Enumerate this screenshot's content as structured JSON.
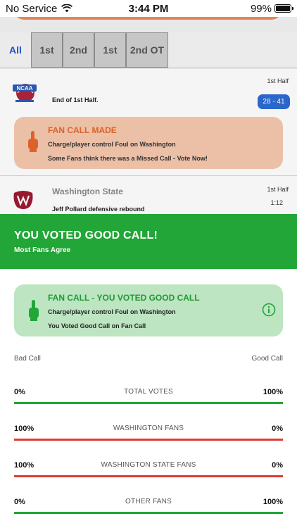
{
  "status": {
    "carrier": "No Service",
    "time": "3:44 PM",
    "battery_pct": "99%",
    "battery_level": 0.99
  },
  "tabs": {
    "items": [
      {
        "label": "All",
        "selected": true
      },
      {
        "label": "1st"
      },
      {
        "label": "2nd"
      },
      {
        "label": "1st"
      },
      {
        "label": "2nd OT"
      }
    ]
  },
  "feed": {
    "row1": {
      "text": "End of 1st Half.",
      "half": "1st Half",
      "score": "28 - 41",
      "logo_text": "NCAA"
    },
    "fan_call_made": {
      "title": "FAN CALL MADE",
      "detail": "Charge/player control Foul on Washington",
      "prompt_prefix": "Some Fans think there was a Missed Call - ",
      "prompt_cta": "Vote Now!"
    },
    "row2": {
      "team": "Washington State",
      "text": "Jeff Pollard defensive rebound",
      "half": "1st Half",
      "clock": "1:12"
    }
  },
  "sheet": {
    "banner_title": "YOU VOTED GOOD CALL!",
    "banner_sub": "Most Fans Agree",
    "card": {
      "title": "FAN CALL - YOU VOTED GOOD CALL",
      "detail": "Charge/player control Foul on Washington",
      "note": "You Voted Good Call on Fan Call"
    },
    "scale_left": "Bad Call",
    "scale_right": "Good Call",
    "rows": [
      {
        "label": "TOTAL VOTES",
        "bad": "0%",
        "good": "100%",
        "good_fraction": 1.0
      },
      {
        "label": "WASHINGTON FANS",
        "bad": "100%",
        "good": "0%",
        "good_fraction": 0.0
      },
      {
        "label": "WASHINGTON STATE FANS",
        "bad": "100%",
        "good": "0%",
        "good_fraction": 0.0
      },
      {
        "label": "OTHER FANS",
        "bad": "0%",
        "good": "100%",
        "good_fraction": 1.0
      }
    ]
  },
  "colors": {
    "good": "#21a637",
    "bad": "#e03c31",
    "accent_blue": "#1e57c8",
    "fan_call_orange": "#e6662c"
  },
  "icons": {
    "wifi": "wifi-icon",
    "battery": "battery-icon",
    "hand": "pointing-hand-icon",
    "info": "info-circle-icon"
  }
}
